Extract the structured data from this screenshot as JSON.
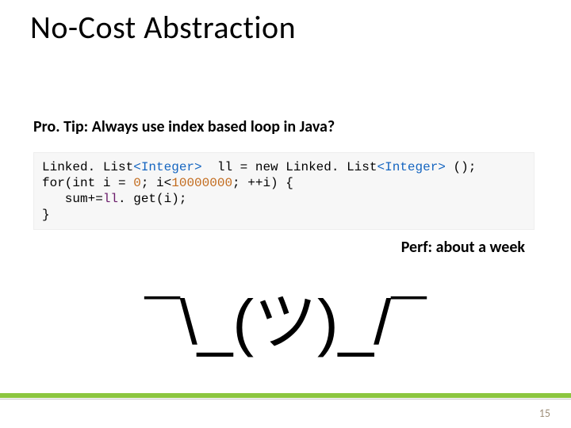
{
  "title": "No-Cost Abstraction",
  "subtitle": "Pro. Tip: Always use index based loop in Java?",
  "code": {
    "l1a": "Linked. List",
    "l1b": "<Integer>",
    "l1c": "  ll = new ",
    "l1d": "Linked. List",
    "l1e": "<Integer>",
    "l1f": " ();",
    "l2a": "for(int i = ",
    "l2b": "0",
    "l2c": "; i<",
    "l2d": "10000000",
    "l2e": "; ++i) {",
    "l3a": "   sum+=",
    "l3b": "ll",
    "l3c": ". get(i);",
    "l4": "}"
  },
  "perf": "Perf: about a week",
  "shrug": "¯\\_(ツ)_/¯",
  "page_number": "15",
  "colors": {
    "accent": "#8cc63f",
    "code_bg": "#f7f7f7",
    "type": "#1565c0",
    "num": "#c26b1d",
    "ident": "#6a1b6a",
    "pagenum": "#9e8f7a"
  }
}
